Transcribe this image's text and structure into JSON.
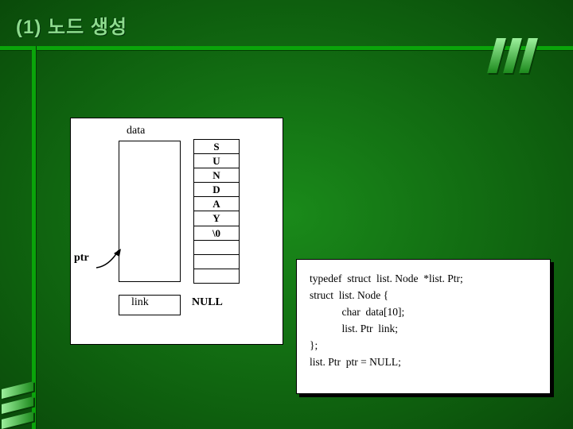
{
  "title": "(1) 노드 생성",
  "diagram": {
    "data_label": "data",
    "link_label": "link",
    "link_value": "NULL",
    "ptr_label": "ptr",
    "chars": [
      "S",
      "U",
      "N",
      "D",
      "A",
      "Y",
      "\\0",
      "",
      "",
      ""
    ]
  },
  "code": {
    "l1": "typedef  struct  list. Node  *list. Ptr;",
    "l2": "struct  list. Node {",
    "l3": "            char  data[10];",
    "l4": "            list. Ptr  link;",
    "l5": "};",
    "l6": "list. Ptr  ptr = NULL;"
  },
  "chart_data": {
    "type": "table",
    "title": "Linked list node layout",
    "node_field_data": {
      "name": "data",
      "type": "char[10]",
      "values": [
        "S",
        "U",
        "N",
        "D",
        "A",
        "Y",
        "\\0",
        "",
        "",
        ""
      ]
    },
    "node_field_link": {
      "name": "link",
      "type": "listPtr",
      "value": "NULL"
    },
    "external_pointer": {
      "name": "ptr",
      "points_to": "node"
    }
  }
}
